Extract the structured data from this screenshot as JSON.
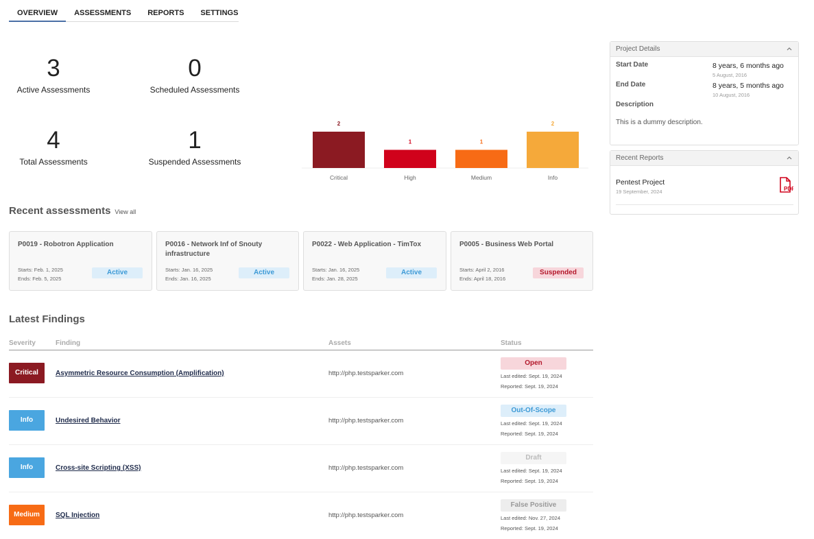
{
  "tabs": [
    "OVERVIEW",
    "ASSESSMENTS",
    "REPORTS",
    "SETTINGS"
  ],
  "stats": [
    {
      "value": "3",
      "label": "Active Assessments"
    },
    {
      "value": "0",
      "label": "Scheduled Assessments"
    },
    {
      "value": "4",
      "label": "Total Assessments"
    },
    {
      "value": "1",
      "label": "Suspended Assessments"
    }
  ],
  "chart_data": {
    "type": "bar",
    "categories": [
      "Critical",
      "High",
      "Medium",
      "Info"
    ],
    "values": [
      2,
      1,
      1,
      2
    ],
    "colors": [
      "#8b1a22",
      "#d0021b",
      "#f76b15",
      "#f5a93a"
    ],
    "ylim": [
      0,
      2
    ]
  },
  "recent": {
    "title": "Recent assessments",
    "view_all": "View all",
    "items": [
      {
        "title": "P0019 - Robotron Application",
        "starts": "Starts: Feb. 1, 2025",
        "ends": "Ends: Feb. 5, 2025",
        "status": "Active"
      },
      {
        "title": "P0016 - Network Inf of Snouty infrastructure",
        "starts": "Starts: Jan. 16, 2025",
        "ends": "Ends: Jan. 16, 2025",
        "status": "Active"
      },
      {
        "title": "P0022 - Web Application - TimTox",
        "starts": "Starts: Jan. 16, 2025",
        "ends": "Ends: Jan. 28, 2025",
        "status": "Active"
      },
      {
        "title": "P0005 - Business Web Portal",
        "starts": "Starts: April 2, 2016",
        "ends": "Ends: April 18, 2016",
        "status": "Suspended"
      }
    ]
  },
  "findings": {
    "title": "Latest Findings",
    "headers": {
      "severity": "Severity",
      "finding": "Finding",
      "assets": "Assets",
      "status": "Status"
    },
    "rows": [
      {
        "severity": "Critical",
        "sev_color": "#8b1a22",
        "name": "Asymmetric Resource Consumption (Amplification)",
        "asset": "http://php.testsparker.com",
        "status": "Open",
        "status_bg": "#f7d6db",
        "status_fg": "#b3182b",
        "edited": "Last edited: Sept. 19, 2024",
        "reported": "Reported: Sept. 19, 2024"
      },
      {
        "severity": "Info",
        "sev_color": "#4aa6e0",
        "name": "Undesired Behavior",
        "asset": "http://php.testsparker.com",
        "status": "Out-Of-Scope",
        "status_bg": "#ddeefa",
        "status_fg": "#3d9ad6",
        "edited": "Last edited: Sept. 19, 2024",
        "reported": "Reported: Sept. 19, 2024"
      },
      {
        "severity": "Info",
        "sev_color": "#4aa6e0",
        "name": "Cross-site Scripting (XSS)",
        "asset": "http://php.testsparker.com",
        "status": "Draft",
        "status_bg": "#f5f5f5",
        "status_fg": "#bbbbbb",
        "edited": "Last edited: Sept. 19, 2024",
        "reported": "Reported: Sept. 19, 2024"
      },
      {
        "severity": "Medium",
        "sev_color": "#f76b15",
        "name": "SQL Injection",
        "asset": "http://php.testsparker.com",
        "status": "False Positive",
        "status_bg": "#ededed",
        "status_fg": "#999999",
        "edited": "Last edited: Nov. 27, 2024",
        "reported": "Reported: Sept. 19, 2024"
      }
    ]
  },
  "project": {
    "title": "Project Details",
    "start_label": "Start Date",
    "start_value": "8 years, 6 months ago",
    "start_date": "5 August, 2016",
    "end_label": "End Date",
    "end_value": "8 years, 5 months ago",
    "end_date": "10 August, 2016",
    "desc_label": "Description",
    "desc_value": "This is a dummy description."
  },
  "reports": {
    "title": "Recent Reports",
    "items": [
      {
        "name": "Pentest Project",
        "date": "19 September, 2024",
        "icon": "pdf-file-icon"
      }
    ]
  }
}
